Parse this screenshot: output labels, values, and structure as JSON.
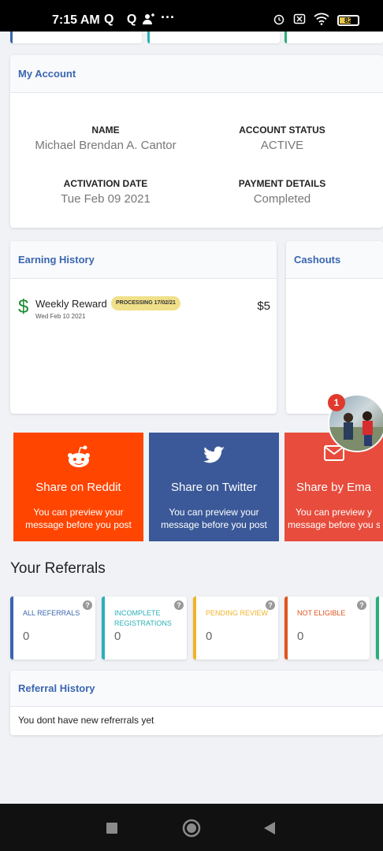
{
  "status_bar": {
    "time": "7:15 AM",
    "left_icons": "Q Q",
    "dots": "···",
    "battery": "82"
  },
  "account": {
    "title": "My Account",
    "name_label": "NAME",
    "name_value": "Michael Brendan A. Cantor",
    "status_label": "ACCOUNT STATUS",
    "status_value": "ACTIVE",
    "activation_label": "ACTIVATION DATE",
    "activation_value": "Tue Feb 09 2021",
    "payment_label": "PAYMENT DETAILS",
    "payment_value": "Completed"
  },
  "earning": {
    "title": "Earning History",
    "item_icon": "$",
    "item_title": "Weekly Reward",
    "item_date": "Wed Feb 10 2021",
    "item_badge": "PROCESSING 17/02/21",
    "item_amount": "$5"
  },
  "cashouts": {
    "title": "Cashouts"
  },
  "share": [
    {
      "title": "Share on Reddit",
      "desc1": "You can preview your",
      "desc2": "message before you post",
      "color": "#ff4500",
      "icon": "reddit-icon"
    },
    {
      "title": "Share on Twitter",
      "desc1": "You can preview your",
      "desc2": "message before you post",
      "color": "#3b5998",
      "icon": "twitter-icon"
    },
    {
      "title": "Share by Ema",
      "desc1": "You can preview y",
      "desc2": "message before you s",
      "color": "#e74c3c",
      "icon": "mail-icon"
    }
  ],
  "referrals": {
    "title": "Your Referrals",
    "stats": [
      {
        "label": "ALL REFERRALS",
        "value": "0",
        "color": "#3a66b0"
      },
      {
        "label": "INCOMPLETE REGISTRATIONS",
        "value": "0",
        "color": "#2ab0b8"
      },
      {
        "label": "PENDING REVIEW",
        "value": "0",
        "color": "#f0b429"
      },
      {
        "label": "NOT ELIGIBLE",
        "value": "0",
        "color": "#e0541e"
      }
    ],
    "history_title": "Referral History",
    "history_empty": "You dont have new refrerrals yet"
  },
  "chat_bubble": {
    "count": "1"
  }
}
